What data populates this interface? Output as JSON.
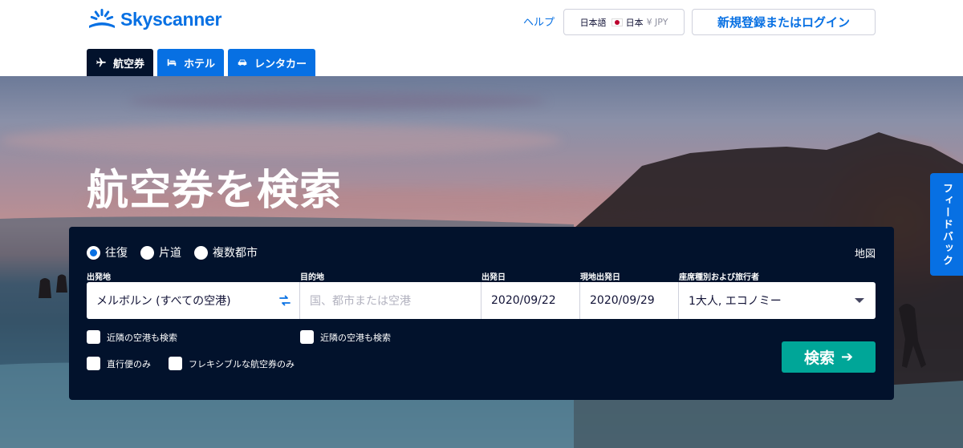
{
  "brand": {
    "name": "Skyscanner",
    "color": "#0770e3"
  },
  "header": {
    "help_label": "ヘルプ",
    "locale": {
      "language": "日本語",
      "country": "日本",
      "currency": "¥ JPY"
    },
    "login_label": "新規登録またはログイン"
  },
  "tabs": [
    {
      "label": "航空券",
      "icon": "plane-icon",
      "active": true
    },
    {
      "label": "ホテル",
      "icon": "bed-icon",
      "active": false
    },
    {
      "label": "レンタカー",
      "icon": "car-icon",
      "active": false
    }
  ],
  "hero": {
    "title": "航空券を検索"
  },
  "feedback_label": "フィードバック",
  "search": {
    "trip_types": [
      {
        "label": "往復",
        "checked": true
      },
      {
        "label": "片道",
        "checked": false
      },
      {
        "label": "複数都市",
        "checked": false
      }
    ],
    "map_label": "地図",
    "fields": {
      "origin": {
        "label": "出発地",
        "value": "メルボルン (すべての空港)"
      },
      "destination": {
        "label": "目的地",
        "placeholder": "国、都市または空港"
      },
      "depart": {
        "label": "出発日",
        "value": "2020/09/22"
      },
      "return": {
        "label": "現地出発日",
        "value": "2020/09/29"
      },
      "cabin": {
        "label": "座席種別および旅行者",
        "value": "1大人, エコノミー"
      }
    },
    "checkboxes": {
      "nearby_origin": "近隣の空港も検索",
      "nearby_destination": "近隣の空港も検索",
      "direct_only": "直行便のみ",
      "flexible_only": "フレキシブルな航空券のみ"
    },
    "search_button": "検索",
    "search_button_color": "#00a698",
    "panel_color": "#02122c"
  }
}
